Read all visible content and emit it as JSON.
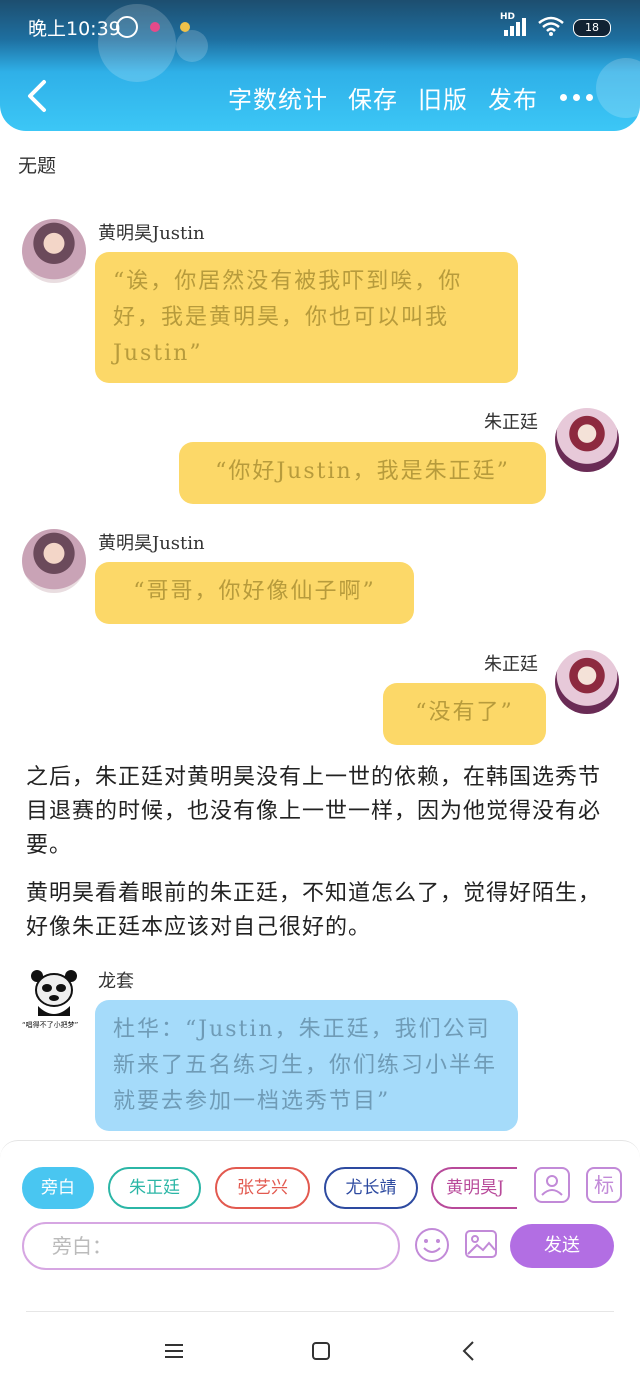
{
  "status_bar": {
    "time": "晚上10:39",
    "network_label": "HD",
    "battery": "18"
  },
  "nav": {
    "word_count_label": "字数统计",
    "save_label": "保存",
    "old_version_label": "旧版",
    "publish_label": "发布"
  },
  "title_placeholder": "无题",
  "messages": [
    {
      "speaker": "黄明昊Justin",
      "text": "“诶，你居然没有被我吓到唉，你好，我是黄明昊，你也可以叫我Justin”"
    },
    {
      "speaker": "朱正廷",
      "text": "“你好Justin，我是朱正廷”"
    },
    {
      "speaker": "黄明昊Justin",
      "text": "“哥哥，你好像仙子啊”"
    },
    {
      "speaker": "朱正廷",
      "text": "“没有了”"
    },
    {
      "speaker": "龙套",
      "text": "杜华：“Justin，朱正廷，我们公司新来了五名练习生，你们练习小半年就要去参加一档选秀节目”"
    }
  ],
  "narration": [
    "之后，朱正廷对黄明昊没有上一世的依赖，在韩国选秀节目退赛的时候，也没有像上一世一样，因为他觉得没有必要。",
    "黄明昊看着眼前的朱正廷，不知道怎么了，觉得好陌生，好像朱正廷本应该对自己很好的。"
  ],
  "meme_caption": "“唱得不了小把梦”",
  "role_chips": [
    "旁白",
    "朱正廷",
    "张艺兴",
    "尤长靖",
    "黄明昊J"
  ],
  "role_icon_label": "标",
  "composer": {
    "placeholder": "旁白：",
    "send_label": "发送"
  },
  "colors": {
    "accent": "#3cc7f6",
    "bubble_yellow": "#fcd868",
    "bubble_blue": "#a5dbfa",
    "send_button": "#b26ee3",
    "chip_zhu": "#2bb6a6",
    "chip_zhang": "#e2594f",
    "chip_you": "#2d4aa0",
    "chip_huang": "#b84a9a"
  },
  "icons": [
    "back-icon",
    "more-icon",
    "avatar-icon",
    "emoji-icon",
    "image-icon",
    "menu-icon",
    "home-icon",
    "nav-back-icon"
  ]
}
